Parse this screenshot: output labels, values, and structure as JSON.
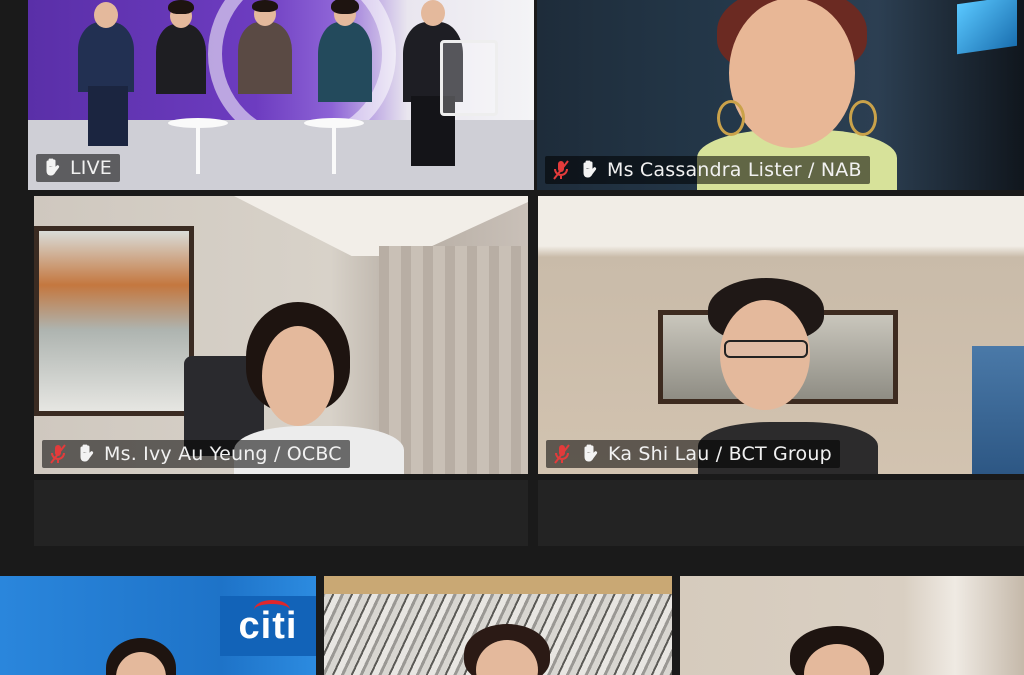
{
  "tiles": {
    "live": {
      "label": "LIVE"
    },
    "cassandra": {
      "label": "Ms Cassandra Lister / NAB"
    },
    "ivy": {
      "label": "Ms. Ivy Au Yeung / OCBC"
    },
    "kashi": {
      "label": "Ka Shi Lau / BCT Group"
    },
    "citi": {
      "logo_text": "citi"
    }
  },
  "colors": {
    "active_border": "#c7e04a",
    "muted_icon": "#e33b3b",
    "citi_blue": "#1e73c8"
  },
  "icons": {
    "mic_muted": "mic-muted-icon",
    "raised_hand": "hand-icon"
  }
}
